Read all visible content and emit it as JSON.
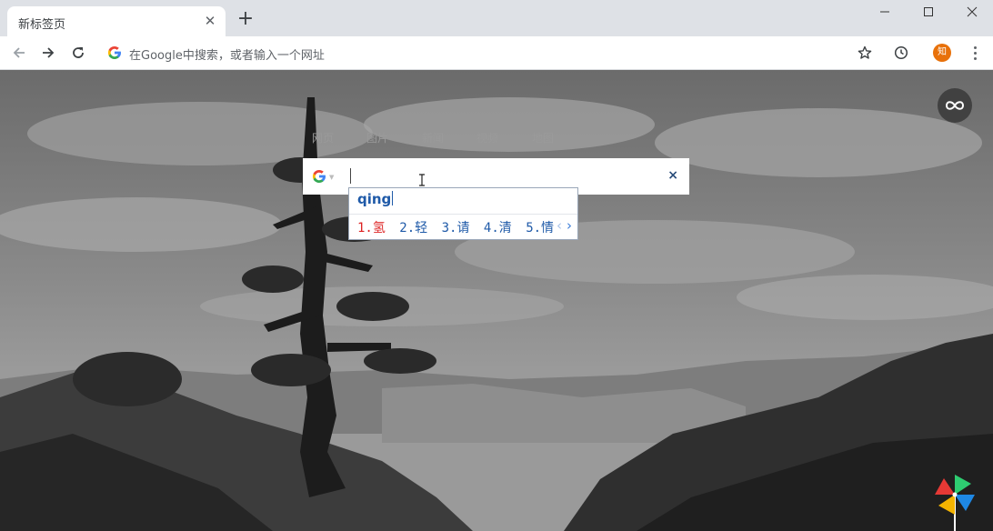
{
  "tab": {
    "title": "新标签页",
    "close_glyph": "✕",
    "new_tab_glyph": "+"
  },
  "window_controls": [
    "minimize",
    "maximize",
    "close"
  ],
  "toolbar": {
    "back_icon": "arrow-left-icon",
    "forward_icon": "arrow-right-icon",
    "reload_icon": "reload-icon",
    "omnibox_placeholder": "在Google中搜索，或者输入一个网址",
    "bookmark_icon": "star-icon",
    "history_icon": "clock-icon",
    "profile_avatar_text": "知",
    "menu_icon": "vertical-dots-icon"
  },
  "search_tabs": [
    "网页",
    "图片",
    "新闻",
    "视频",
    "地图"
  ],
  "search_box": {
    "engine_icon": "google-g-icon",
    "value": "",
    "clear_glyph": "×"
  },
  "ime": {
    "composition": "qing",
    "candidates": [
      "1.氢",
      "2.轻",
      "3.请",
      "4.清",
      "5.情"
    ],
    "prev_glyph": "‹",
    "next_glyph": "›"
  },
  "colors": {
    "tabstrip_bg": "#dee1e6",
    "accent_orange": "#e8710a",
    "ime_blue": "#1f5aa8",
    "ime_highlight": "#dd2222"
  }
}
